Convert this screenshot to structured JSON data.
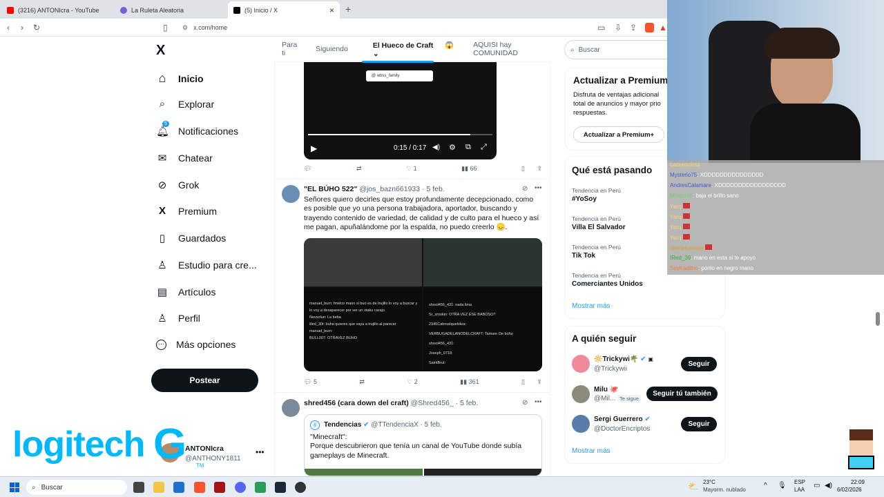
{
  "browser": {
    "tabs": [
      {
        "label": "(3216) ANTONIcra - YouTube",
        "color": "#ff0000"
      },
      {
        "label": "La Ruleta Aleatoria",
        "color": "#7b5cd6"
      },
      {
        "label": "(5) Inicio / X",
        "color": "#000000"
      }
    ],
    "new_tab": "+",
    "close": "×",
    "url": "x.com/home"
  },
  "nav": {
    "items": [
      {
        "label": "Inicio",
        "icon": "home-icon",
        "glyph": "⌂"
      },
      {
        "label": "Explorar",
        "icon": "search-icon",
        "glyph": "⌕"
      },
      {
        "label": "Notificaciones",
        "icon": "bell-icon",
        "glyph": "♫",
        "badge": "5"
      },
      {
        "label": "Chatear",
        "icon": "mail-icon",
        "glyph": "✉"
      },
      {
        "label": "Grok",
        "icon": "grok-icon",
        "glyph": "⊘"
      },
      {
        "label": "Premium",
        "icon": "x-icon",
        "glyph": "𝕏"
      },
      {
        "label": "Guardados",
        "icon": "bookmark-icon",
        "glyph": "▯"
      },
      {
        "label": "Estudio para cre...",
        "icon": "studio-icon",
        "glyph": "♙"
      },
      {
        "label": "Artículos",
        "icon": "article-icon",
        "glyph": "▤"
      },
      {
        "label": "Perfil",
        "icon": "profile-icon",
        "glyph": "♙"
      },
      {
        "label": "Más opciones",
        "icon": "more-icon",
        "glyph": "⋯"
      }
    ],
    "post_button": "Postear",
    "account_name": "ANTONIcra",
    "account_handle": "@ANTHONY1811",
    "logo": "X"
  },
  "feed_tabs": [
    "Para ti",
    "Siguiendo",
    "El Hueco de Craft",
    "AQUISI hay COMUNIDAD"
  ],
  "video": {
    "time": "0:15 / 0:17",
    "search_text": "@ wbss_family",
    "progress": 0.88
  },
  "tweet0_actions": {
    "reply": "",
    "retweet": "",
    "like": "1",
    "views": "66"
  },
  "tweet1": {
    "name": "\"EL BÚHO 522\"",
    "handle": "@jos_bazn661933",
    "date": "· 5 feb.",
    "text": "Señores quiero decirles que estoy profundamente decepcionado, como es posible que yo una persona trabajadora, aportador, buscando y trayendo contenido de variedad, de calidad y de culto para el hueco y así me pagan, apuñalándome por la espalda, no puedo creerlo 😞.",
    "actions": {
      "reply": "5",
      "like": "2",
      "views": "361"
    },
    "img_lines_left": [
      "manuel_bum: fmelco mano si buo es de trujillo lo voy a buscar y lo voy a desaparecer por ser un otaku carajo",
      "Nevsolun: La beba",
      "illed_30t: buho quieres que vaya a trujillo al parecer",
      "manuel_bum:",
      "BULL007: OTRAVEZ BUHO"
    ],
    "img_lines_right": [
      "shred456_431: nada lima",
      "Sr_smokin: OTRA VEZ ESE BABOSO?",
      "2345Cabroelquelolea:",
      "VERBUGADELANODELCRAFT: Tamare Oe búho",
      "shred456_431:",
      "Joseph_0718:",
      "SaintBrut:"
    ]
  },
  "tweet2": {
    "name": "shred456 (cara down del craft)",
    "handle": "@Shred456_",
    "date": "· 5 feb.",
    "quote_name": "Tendencias",
    "quote_handle": "@TTendenciaX",
    "quote_date": "· 5 feb.",
    "quote_text": "\"Minecraft\":\nPorque descubrieron que tenía un canal de YouTube donde subía gameplays de Minecraft."
  },
  "right": {
    "search_placeholder": "Buscar",
    "premium_title": "Actualizar a Premium",
    "premium_text": "Disfruta de ventajas adicional total de anuncios y mayor prio respuestas.",
    "premium_button": "Actualizar a Premium+",
    "trends_title": "Qué está pasando",
    "trends": [
      {
        "context": "Tendencia en Perú",
        "title": "#YoSoy"
      },
      {
        "context": "Tendencia en Perú",
        "title": "Villa El Salvador"
      },
      {
        "context": "Tendencia en Perú",
        "title": "Tik Tok"
      },
      {
        "context": "Tendencia en Perú",
        "title": "Comerciantes Unidos"
      }
    ],
    "show_more": "Mostrar más",
    "follow_title": "A quién seguir",
    "follows": [
      {
        "name": "🔆Trickywi🌴",
        "handle": "@Trickywii",
        "button": "Seguir",
        "badge": ""
      },
      {
        "name": "Milu 🐙",
        "handle": "@Mil...",
        "button": "Seguir tú también",
        "badge": "Te sigue"
      },
      {
        "name": "Sergi Guerrero",
        "handle": "@DoctorEncriptos",
        "button": "Seguir",
        "badge": ""
      }
    ],
    "show_more2": "Mostrar más"
  },
  "chat": [
    {
      "user": "Laquesoleta",
      "msg": ""
    },
    {
      "user": "Mysterio75",
      "msg": ": XDDDDDDDDDDDDDDD"
    },
    {
      "user": "AndresCalamare",
      "msg": ": XDDDDDDDDDDDDDDDDD"
    },
    {
      "user": "Minecraft",
      "msg": ": baja el brillo sano"
    },
    {
      "user": "Yarq",
      "msg": ""
    },
    {
      "user": "Yarq",
      "msg": ""
    },
    {
      "user": "Yarq",
      "msg": ""
    },
    {
      "user": "Yarq",
      "msg": ""
    },
    {
      "user": "charlelcocosa",
      "msg": ""
    },
    {
      "user": "IRed_39",
      "msg": ": mano en esta si te apoyo"
    },
    {
      "user": "SoyKaditno",
      "msg": ": ponlo en negro mano"
    }
  ],
  "overlay": {
    "logo_text": "logitech",
    "logo_letter": "G",
    "tm": "TM"
  },
  "taskbar": {
    "search": "Buscar",
    "weather_temp": "23°C",
    "weather_desc": "Mayorm. nublado",
    "lang1": "ESP",
    "lang2": "LAA",
    "time": "22:09",
    "date": "6/02/2026"
  },
  "colors": {
    "accent": "#1d9bf0",
    "dark": "#0f1419",
    "logitech": "#00b8fc"
  }
}
